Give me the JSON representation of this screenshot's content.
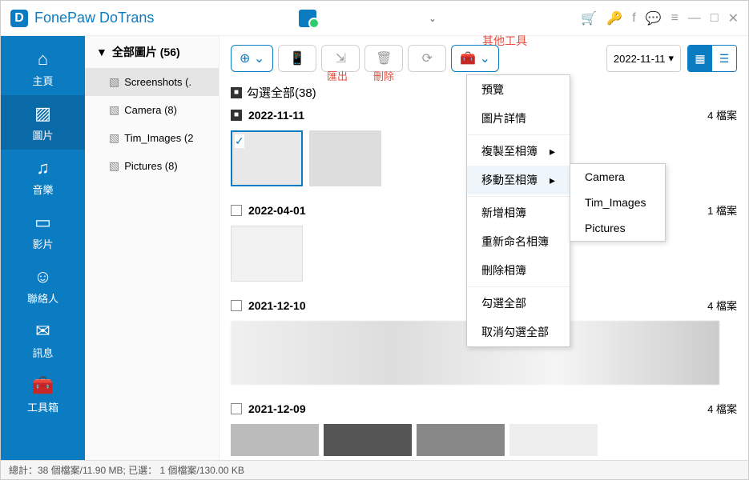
{
  "app": {
    "title": "FonePaw DoTrans"
  },
  "nav": [
    {
      "icon": "⌂",
      "label": "主頁"
    },
    {
      "icon": "▨",
      "label": "圖片"
    },
    {
      "icon": "♫",
      "label": "音樂"
    },
    {
      "icon": "▭",
      "label": "影片"
    },
    {
      "icon": "☺",
      "label": "聯絡人"
    },
    {
      "icon": "✉",
      "label": "訊息"
    },
    {
      "icon": "🧰",
      "label": "工具箱"
    }
  ],
  "albums": {
    "header": "全部圖片 (56)",
    "items": [
      {
        "label": "Screenshots (."
      },
      {
        "label": "Camera (8)"
      },
      {
        "label": "Tim_Images (2"
      },
      {
        "label": "Pictures (8)"
      }
    ]
  },
  "toolbar": {
    "date": "2022-11-11",
    "annot_export": "匯出",
    "annot_delete": "刪除",
    "annot_tools": "其他工具"
  },
  "select_all": {
    "label": "勾選全部(38)"
  },
  "groups": [
    {
      "date": "2022-11-11",
      "count": "4 檔案",
      "checked": true
    },
    {
      "date": "2022-04-01",
      "count": "1 檔案",
      "checked": false
    },
    {
      "date": "2021-12-10",
      "count": "4 檔案",
      "checked": false
    },
    {
      "date": "2021-12-09",
      "count": "4 檔案",
      "checked": false
    }
  ],
  "menu": {
    "items": [
      {
        "label": "預覽"
      },
      {
        "label": "圖片詳情"
      },
      {
        "label": "複製至相簿",
        "sub": true
      },
      {
        "label": "移動至相簿",
        "sub": true,
        "hover": true
      },
      {
        "label": "新增相簿"
      },
      {
        "label": "重新命名相簿"
      },
      {
        "label": "刪除相簿"
      },
      {
        "label": "勾選全部"
      },
      {
        "label": "取消勾選全部"
      }
    ],
    "submenu": [
      "Camera",
      "Tim_Images",
      "Pictures"
    ]
  },
  "status": "總計：38 個檔案/11.90 MB; 已選： 1 個檔案/130.00 KB"
}
